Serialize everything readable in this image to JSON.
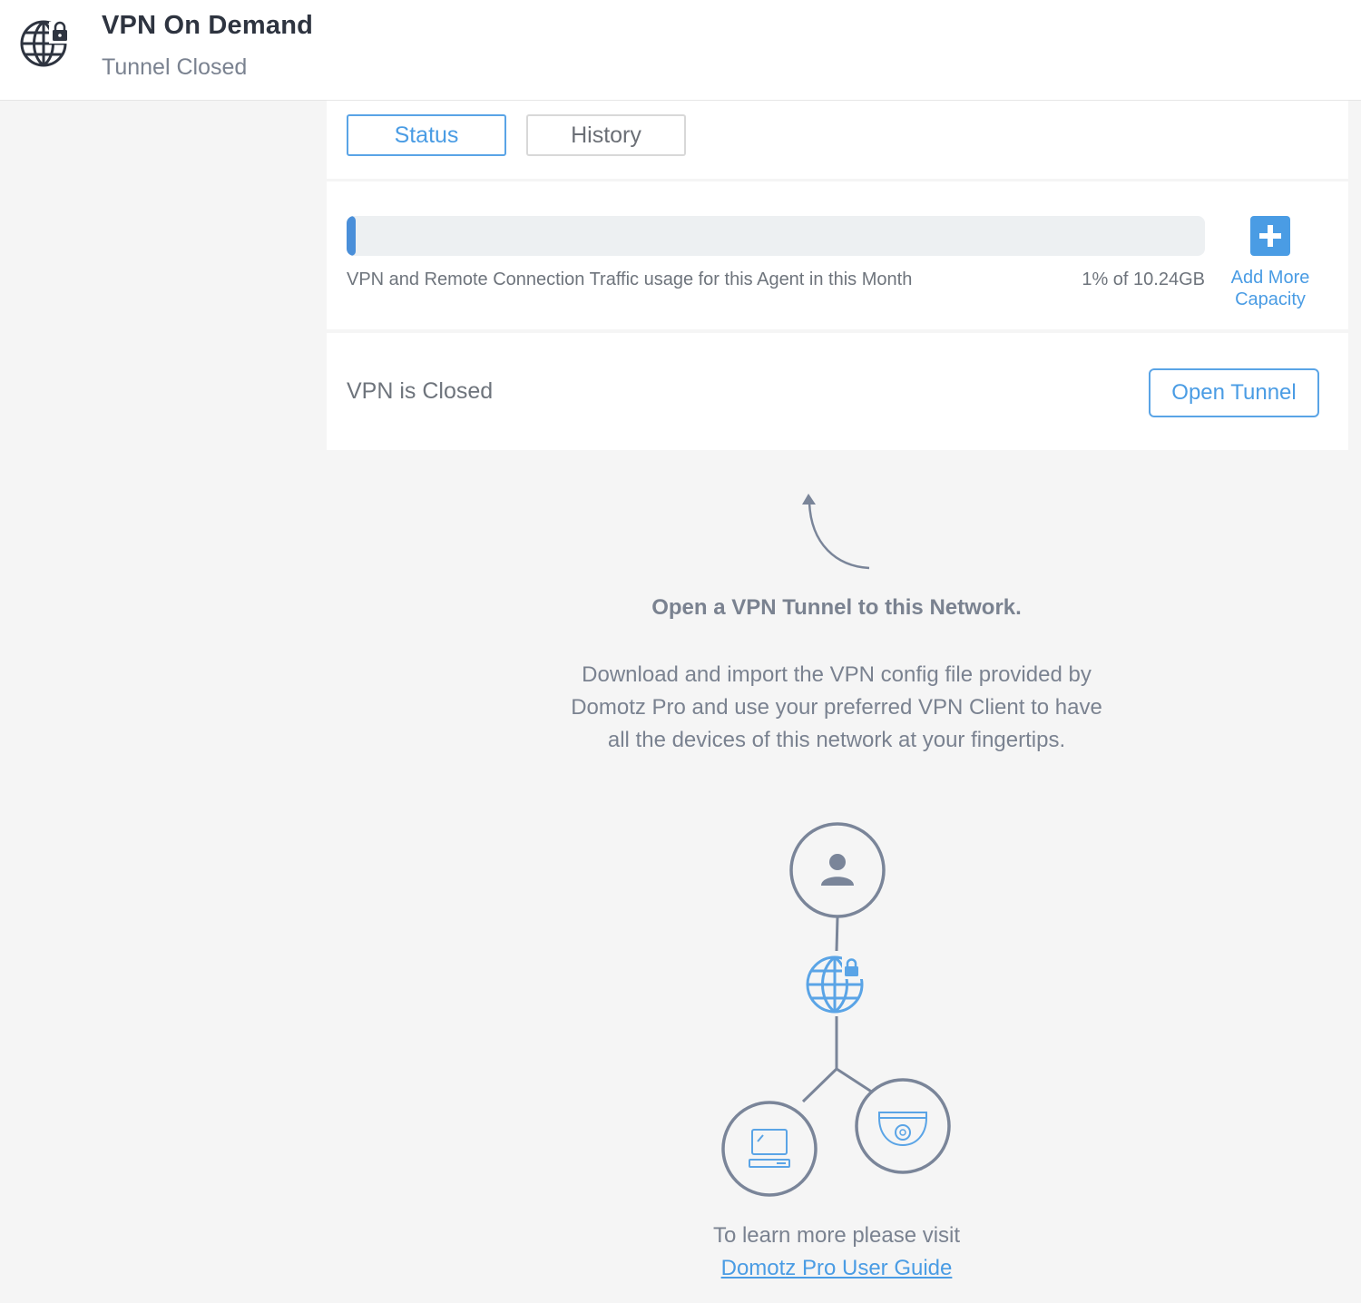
{
  "header": {
    "title": "VPN On Demand",
    "subtitle": "Tunnel Closed",
    "icon": "globe-lock-icon"
  },
  "tabs": [
    {
      "label": "Status",
      "active": true
    },
    {
      "label": "History",
      "active": false
    }
  ],
  "usage": {
    "label": "VPN and Remote Connection Traffic usage for this Agent in this Month",
    "value_text": "1% of 10.24GB",
    "percent": 1,
    "add_capacity_line1": "Add More",
    "add_capacity_line2": "Capacity"
  },
  "vpn": {
    "status_text": "VPN is Closed",
    "open_button_label": "Open Tunnel"
  },
  "empty_state": {
    "title": "Open a VPN Tunnel to this Network.",
    "description": "Download and import the VPN config file provided by Domotz Pro and use your preferred VPN Client to have all the devices of this network at your fingertips.",
    "learn_more": "To learn more please visit",
    "link_text": "Domotz Pro User Guide"
  },
  "colors": {
    "accent": "#4a9ce4",
    "muted_text": "#7a8290",
    "diagram_stroke": "#7a8599"
  }
}
